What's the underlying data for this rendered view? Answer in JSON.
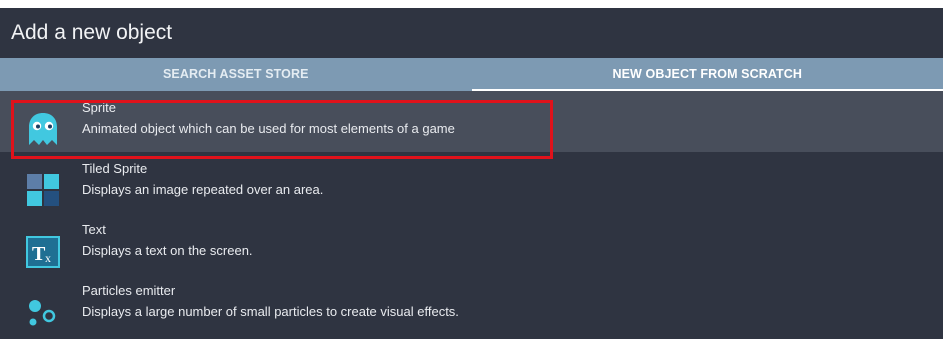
{
  "dialog": {
    "title": "Add a new object"
  },
  "tabs": [
    {
      "label": "SEARCH ASSET STORE",
      "active": false
    },
    {
      "label": "NEW OBJECT FROM SCRATCH",
      "active": true
    }
  ],
  "objects": [
    {
      "icon": "ghost-sprite-icon",
      "title": "Sprite",
      "description": "Animated object which can be used for most elements of a game",
      "selected": true
    },
    {
      "icon": "tiled-sprite-icon",
      "title": "Tiled Sprite",
      "description": "Displays an image repeated over an area.",
      "selected": false
    },
    {
      "icon": "text-object-icon",
      "title": "Text",
      "description": "Displays a text on the screen.",
      "selected": false
    },
    {
      "icon": "particles-emitter-icon",
      "title": "Particles emitter",
      "description": "Displays a large number of small particles to create visual effects.",
      "selected": false
    }
  ],
  "colors": {
    "dialog_bg": "#2f3441",
    "tab_bar": "#7d9ab3",
    "selected_row": "#484e5b",
    "highlight_box": "#e0121b"
  }
}
